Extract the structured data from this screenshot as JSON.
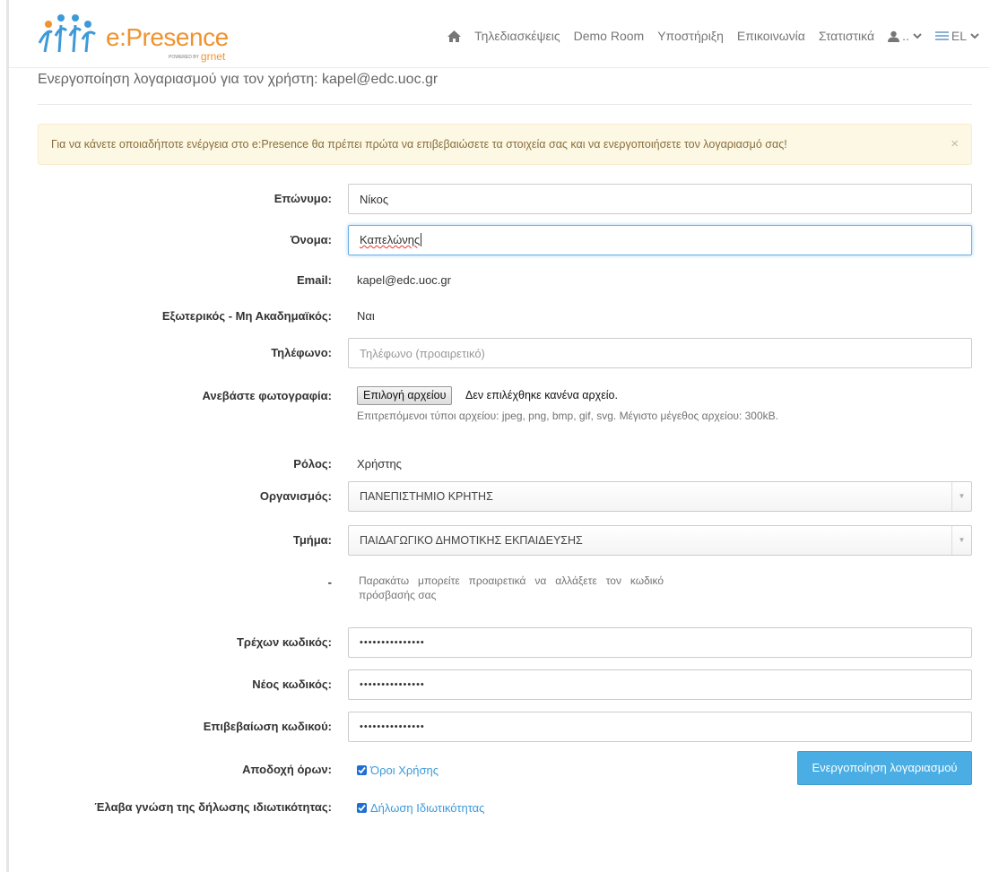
{
  "header": {
    "logo_text": "e:Presence",
    "logo_sub_small": "POWERED BY",
    "logo_sub": "grnet",
    "nav": [
      {
        "label": "Τηλεδιασκέψεις"
      },
      {
        "label": "Demo Room"
      },
      {
        "label": "Υποστήριξη"
      },
      {
        "label": "Επικοινωνία"
      },
      {
        "label": "Στατιστικά"
      }
    ],
    "user_menu_label": "..",
    "language_label": "EL"
  },
  "page": {
    "heading": "Ενεργοποίηση λογαριασμού για τον χρήστη: kapel@edc.uoc.gr"
  },
  "alert": {
    "text": "Για να κάνετε οποιαδήποτε ενέργεια στο e:Presence θα πρέπει πρώτα να επιβεβαιώσετε τα στοιχεία σας και να ενεργοποιήσετε τον λογαριασμό σας!",
    "close": "×"
  },
  "form": {
    "surname": {
      "label": "Επώνυμο:",
      "value": "Νίκος"
    },
    "name": {
      "label": "Όνομα:",
      "value": "Καπελώνης"
    },
    "email": {
      "label": "Email:",
      "value": "kapel@edc.uoc.gr"
    },
    "external": {
      "label": "Εξωτερικός - Μη Ακαδημαϊκός:",
      "value": "Ναι"
    },
    "phone": {
      "label": "Τηλέφωνο:",
      "placeholder": "Τηλέφωνο (προαιρετικό)",
      "value": ""
    },
    "photo": {
      "label": "Ανεβάστε φωτογραφία:",
      "button": "Επιλογή αρχείου",
      "no_file": "Δεν επιλέχθηκε κανένα αρχείο.",
      "help": "Επιτρεπόμενοι τύποι αρχείου: jpeg, png, bmp, gif, svg. Μέγιστο μέγεθος αρχείου: 300kB."
    },
    "role": {
      "label": "Ρόλος:",
      "value": "Χρήστης"
    },
    "organization": {
      "label": "Οργανισμός:",
      "value": "ΠΑΝΕΠΙΣΤΗΜΙΟ ΚΡΗΤΗΣ"
    },
    "department": {
      "label": "Τμήμα:",
      "value": "ΠΑΙΔΑΓΩΓΙΚΟ ΔΗΜΟΤΙΚΗΣ ΕΚΠΑΙΔΕΥΣΗΣ"
    },
    "password_note": {
      "label": "-",
      "text": "Παρακάτω μπορείτε προαιρετικά να αλλάξετε τον κωδικό πρόσβασής σας"
    },
    "current_password": {
      "label": "Τρέχων κωδικός:",
      "value": "•••••••••••••••"
    },
    "new_password": {
      "label": "Νέος κωδικός:",
      "value": "•••••••••••••••"
    },
    "confirm_password": {
      "label": "Επιβεβαίωση κωδικού:",
      "value": "•••••••••••••••"
    },
    "terms": {
      "label": "Αποδοχή όρων:",
      "link": "Όροι Χρήσης",
      "checked": true
    },
    "privacy": {
      "label": "Έλαβα γνώση της δήλωσης ιδιωτικότητας:",
      "link": "Δήλωση Ιδιωτικότητας",
      "checked": true
    },
    "submit": "Ενεργοποίηση λογαριασμού"
  },
  "colors": {
    "brand_orange": "#f0922e",
    "brand_blue": "#3d9ad9",
    "alert_bg": "#fcf8e3",
    "alert_text": "#8a6d3b",
    "button_bg": "#4aaee4"
  }
}
